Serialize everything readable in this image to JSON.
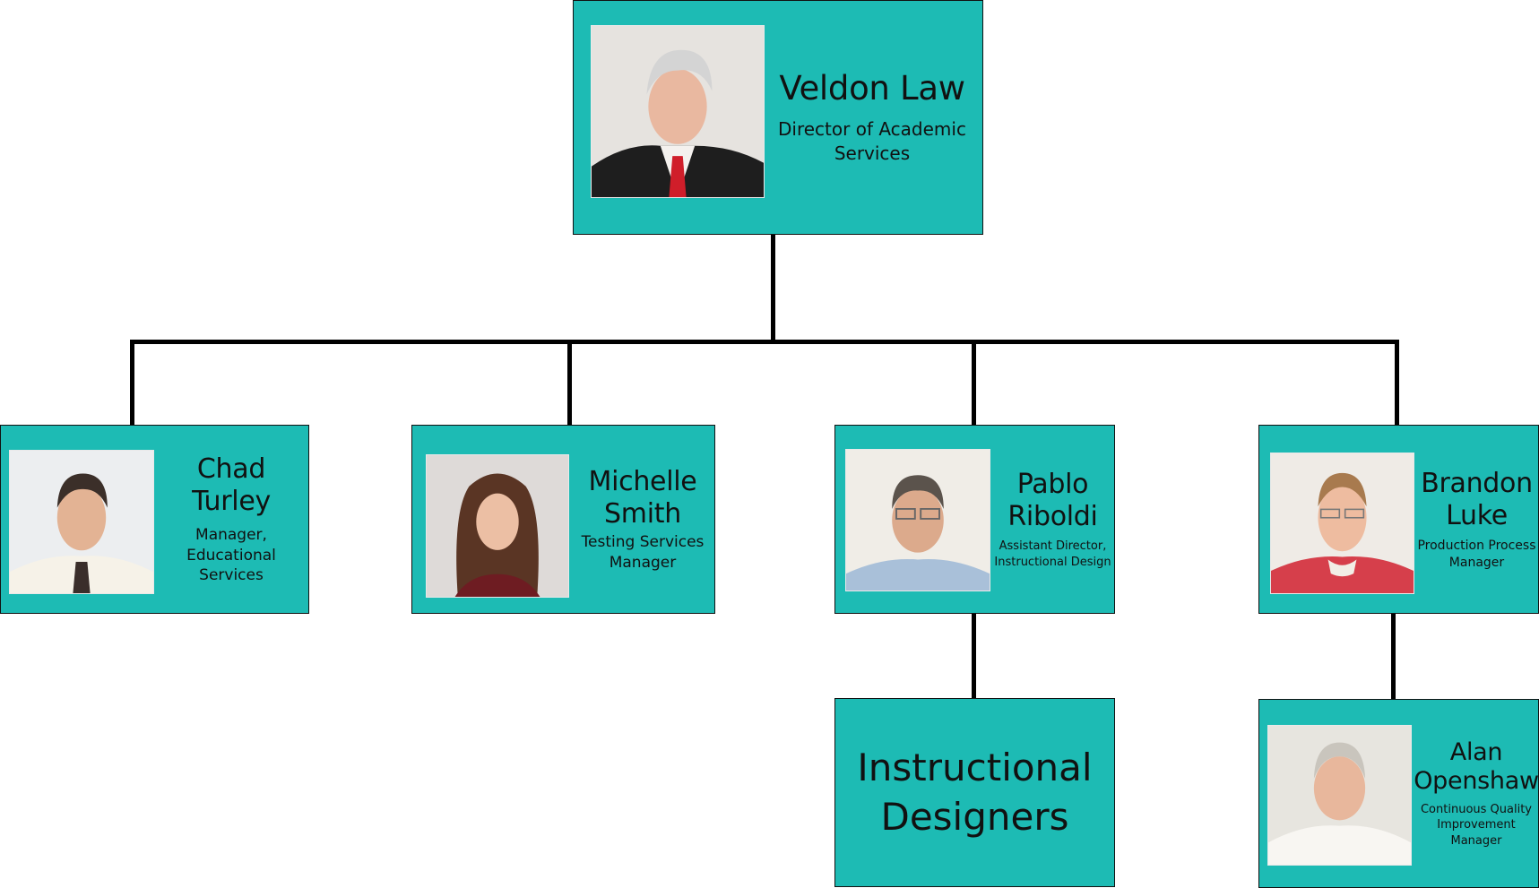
{
  "chart_title": "",
  "colors": {
    "box_fill": "#1dbbb4",
    "connector": "#000000",
    "border": "#111111"
  },
  "nodes": {
    "director": {
      "name": "Veldon Law",
      "title": "Director of Academic Services",
      "photo": "portrait-photo",
      "reports_to": null
    },
    "chad": {
      "name": "Chad Turley",
      "title_lines": [
        "Manager,",
        "Educational Services"
      ],
      "photo": "portrait-photo",
      "reports_to": "Veldon Law"
    },
    "michelle": {
      "name_lines": [
        "Michelle",
        "Smith"
      ],
      "title_lines": [
        "Testing Services",
        "Manager"
      ],
      "photo": "portrait-photo",
      "reports_to": "Veldon Law"
    },
    "pablo": {
      "name_lines": [
        "Pablo",
        "Riboldi"
      ],
      "title_lines": [
        "Assistant Director,",
        "Instructional Design"
      ],
      "photo": "portrait-photo",
      "reports_to": "Veldon Law"
    },
    "brandon": {
      "name_lines": [
        "Brandon",
        "Luke"
      ],
      "title_lines": [
        "Production Process",
        "Manager"
      ],
      "photo": "portrait-photo",
      "reports_to": "Veldon Law"
    },
    "designers": {
      "label_lines": [
        "Instructional",
        "Designers"
      ],
      "reports_to": "Pablo Riboldi"
    },
    "alan": {
      "name_lines": [
        "Alan",
        "Openshaw"
      ],
      "title_lines": [
        "Continuous Quality",
        "Improvement",
        "Manager"
      ],
      "photo": "portrait-photo",
      "reports_to": "Brandon Luke"
    }
  },
  "director_title_lines": [
    "Director of Academic",
    "Services"
  ]
}
